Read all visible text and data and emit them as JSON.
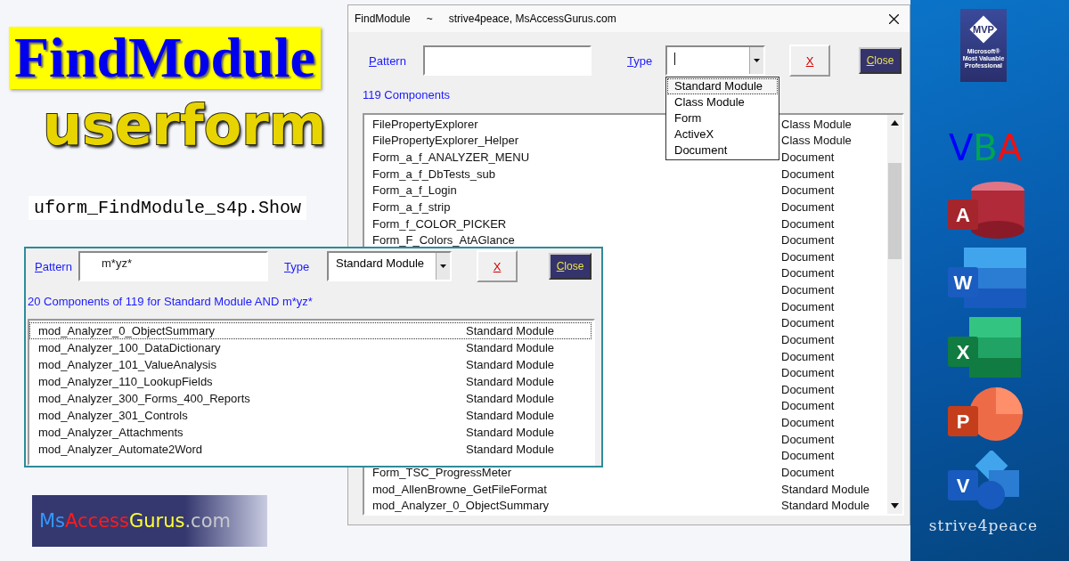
{
  "banner": {
    "title": "FindModule",
    "subtitle": "userform",
    "command": "uform_FindModule_s4p.Show"
  },
  "main_window": {
    "title": "FindModule",
    "separator": "~",
    "credit": "strive4peace, MsAccessGurus.com",
    "pattern_label": "Pattern",
    "type_label": "Type",
    "clear_button": "X",
    "close_button": "Close",
    "count": "119 Components",
    "dropdown": [
      {
        "label": "Standard Module",
        "selected": true
      },
      {
        "label": "Class Module",
        "selected": false
      },
      {
        "label": "Form",
        "selected": false
      },
      {
        "label": "ActiveX",
        "selected": false
      },
      {
        "label": "Document",
        "selected": false
      }
    ],
    "rows": [
      {
        "name": "FilePropertyExplorer",
        "type": "Class Module"
      },
      {
        "name": "FilePropertyExplorer_Helper",
        "type": "Class Module"
      },
      {
        "name": "Form_a_f_ANALYZER_MENU",
        "type": "Document"
      },
      {
        "name": "Form_a_f_DbTests_sub",
        "type": "Document"
      },
      {
        "name": "Form_a_f_Login",
        "type": "Document"
      },
      {
        "name": "Form_a_f_strip",
        "type": "Document"
      },
      {
        "name": "Form_f_COLOR_PICKER",
        "type": "Document"
      },
      {
        "name": "Form_F_Colors_AtAGlance",
        "type": "Document"
      },
      {
        "type": "Document"
      },
      {
        "type": "Document"
      },
      {
        "type": "Document"
      },
      {
        "type": "Document"
      },
      {
        "type": "Document"
      },
      {
        "type": "Document"
      },
      {
        "type": "Document"
      },
      {
        "type": "Document"
      },
      {
        "type": "Document"
      },
      {
        "type": "Document"
      },
      {
        "type": "Document"
      },
      {
        "type": "Document"
      },
      {
        "type": "Document"
      },
      {
        "name": "Form_TSC_ProgressMeter",
        "type": "Document"
      },
      {
        "name": "mod_AllenBrowne_GetFileFormat",
        "type": "Standard Module"
      },
      {
        "name": "mod_Analyzer_0_ObjectSummary",
        "type": "Standard Module"
      }
    ]
  },
  "filter_window": {
    "pattern_label": "Pattern",
    "pattern_value": "m*yz*",
    "type_label": "Type",
    "type_value": "Standard Module",
    "clear_button": "X",
    "close_button": "Close",
    "count": "20 Components of 119 for Standard Module AND m*yz*",
    "rows": [
      {
        "name": "mod_Analyzer_0_ObjectSummary",
        "type": "Standard Module",
        "selected": true
      },
      {
        "name": "mod_Analyzer_100_DataDictionary",
        "type": "Standard Module",
        "selected": false
      },
      {
        "name": "mod_Analyzer_101_ValueAnalysis",
        "type": "Standard Module",
        "selected": false
      },
      {
        "name": "mod_Analyzer_110_LookupFields",
        "type": "Standard Module",
        "selected": false
      },
      {
        "name": "mod_Analyzer_300_Forms_400_Reports",
        "type": "Standard Module",
        "selected": false
      },
      {
        "name": "mod_Analyzer_301_Controls",
        "type": "Standard Module",
        "selected": false
      },
      {
        "name": "mod_Analyzer_Attachments",
        "type": "Standard Module",
        "selected": false
      },
      {
        "name": "mod_Analyzer_Automate2Word",
        "type": "Standard Module",
        "selected": false
      }
    ]
  },
  "logo": [
    {
      "text": "Ms",
      "color": "#3399ff"
    },
    {
      "text": "Access",
      "color": "#ff1a1a"
    },
    {
      "text": "Gurus",
      "color": "#ffff33"
    },
    {
      "text": ".com",
      "color": "#c8c8d0"
    }
  ],
  "sidebar": {
    "mvp": {
      "title": "MVP",
      "brand": "Microsoft®",
      "caption": "Most Valuable Professional"
    },
    "vba": [
      {
        "text": "V",
        "color": "#0000ff"
      },
      {
        "text": "B",
        "color": "#00a651"
      },
      {
        "text": "A",
        "color": "#ee1111"
      }
    ],
    "apps": [
      {
        "kind": "access",
        "letter": "A"
      },
      {
        "kind": "word",
        "letter": "W"
      },
      {
        "kind": "excel",
        "letter": "X"
      },
      {
        "kind": "powerpoint",
        "letter": "P"
      },
      {
        "kind": "visio",
        "letter": "V"
      }
    ],
    "signature": "strive4peace"
  }
}
